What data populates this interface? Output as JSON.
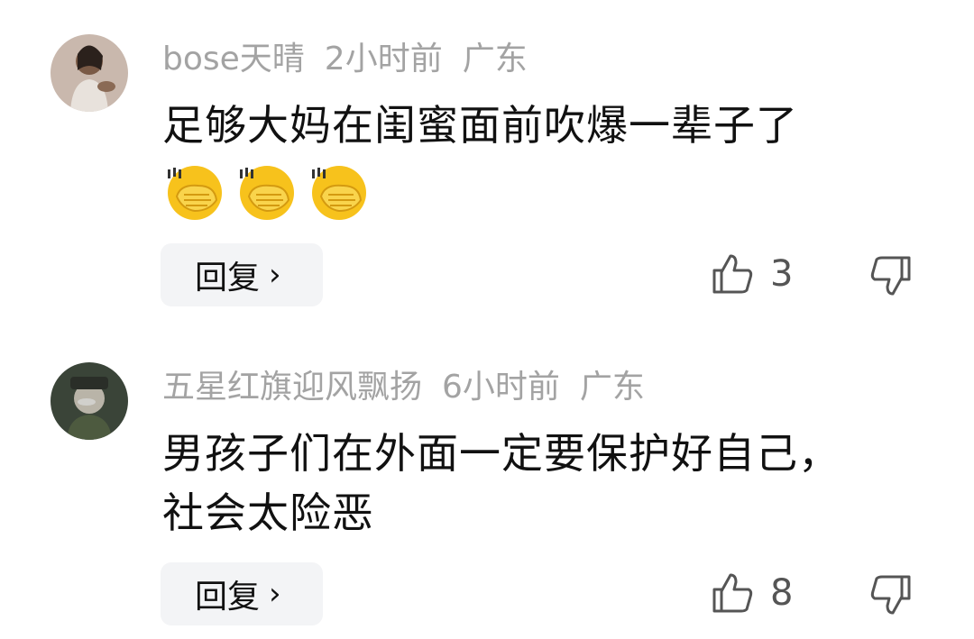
{
  "comments": [
    {
      "username": "bose天晴",
      "time": "2小时前",
      "location": "广东",
      "text": "足够大妈在闺蜜面前吹爆一辈子了",
      "emojis": [
        "facepalm-emoji",
        "facepalm-emoji",
        "facepalm-emoji"
      ],
      "reply_label": "回复",
      "likes": "3"
    },
    {
      "username": "五星红旗迎风飘扬",
      "time": "6小时前",
      "location": "广东",
      "text": "男孩子们在外面一定要保护好自己，社会太险恶",
      "reply_label": "回复",
      "likes": "8"
    }
  ],
  "icons": {
    "like": "thumbs-up-icon",
    "dislike": "thumbs-down-icon",
    "reply_chevron": "›"
  },
  "colors": {
    "meta": "#a3a3a3",
    "text": "#111111",
    "button_bg": "#f3f4f6",
    "emoji_yellow": "#f7c21c"
  }
}
